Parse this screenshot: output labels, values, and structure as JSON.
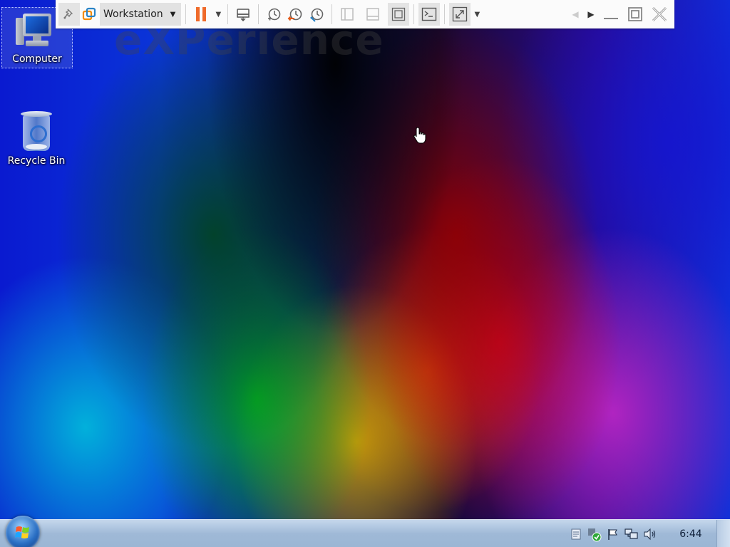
{
  "toolbar": {
    "vm_name": "Workstation",
    "icons": [
      "pin-icon",
      "vmware-logo-icon",
      "pause-icon",
      "send-keys-icon",
      "snapshot-icon",
      "revert-snapshot-icon",
      "snapshot-manager-icon",
      "sidebar-icon",
      "thumbnail-bar-icon",
      "fullscreen-fit-icon",
      "console-icon",
      "stretch-icon"
    ],
    "colors": {
      "pause": "#ef6a2a",
      "vmware_logo": "#f38b00"
    }
  },
  "desktop": {
    "watermark": "eXPerience",
    "icons": [
      {
        "label": "Computer",
        "icon": "computer-icon",
        "selected": true
      },
      {
        "label": "Recycle Bin",
        "icon": "recycle-bin-icon",
        "selected": false
      }
    ]
  },
  "taskbar": {
    "tray_icons": [
      "action-center-icon",
      "security-shield-icon",
      "flag-icon",
      "network-icon",
      "volume-icon"
    ],
    "clock": "6:44"
  }
}
